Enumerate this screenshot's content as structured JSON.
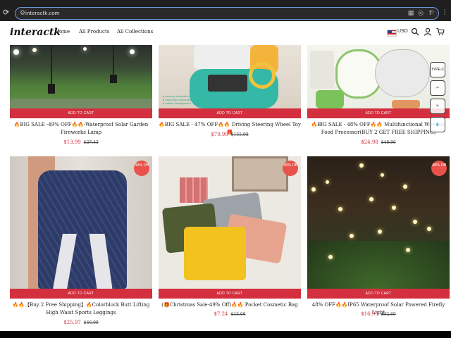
{
  "browser": {
    "url": "interactk.com"
  },
  "header": {
    "logo": "interactk",
    "nav": [
      "Home",
      "All Products",
      "All Collections"
    ],
    "currency": "USD"
  },
  "products": [
    {
      "cart_label": "ADD TO CART",
      "title": "🔥BIG SALE -49% OFF🔥🔥-Waterproof Solar Garden Fireworks Lamp",
      "price": "$13.99",
      "old_price": "$27.43"
    },
    {
      "cart_label": "ADD TO CART",
      "title": "🔥BIG SALE - 47% OFF🔥🔥 Driving Steering Wheel Toy🎁",
      "price": "$79.99",
      "old_price": "$155.98"
    },
    {
      "cart_label": "ADD TO CART",
      "title": "🔥BIG SALE - 48% OFF🔥🔥 Multifunctional Wireless Food Processor(BUY 2 GET FREE SHIPPING)",
      "price": "$24.98",
      "old_price": "$48.96"
    },
    {
      "cart_label": "ADD TO CART",
      "badge": "44% Off",
      "title": "🔥🔥【Buy 2 Free Shipping】🔥Colorblock Butt Lifting High Waist Sports Leggings",
      "price": "$25.97",
      "old_price": "$46.99"
    },
    {
      "cart_label": "ADD TO CART",
      "badge": "46% Off",
      "title": "(🎁Christmas Sale-49% Off)🔥🔥 Pocket Cosmetic Bag",
      "price": "$7.24",
      "old_price": "$13.66"
    },
    {
      "cart_label": "ADD TO CART",
      "badge": "48% Off",
      "title": "48% OFF🔥🔥IP65 Waterproof Solar Powered Firefly Light",
      "price": "$16.95",
      "old_price": "$32.60"
    }
  ],
  "side_icons": [
    "TYPE-C",
    "tool",
    "tool",
    "water"
  ],
  "colors": {
    "accent_red": "#d32f3f",
    "badge": "#e8524a"
  }
}
